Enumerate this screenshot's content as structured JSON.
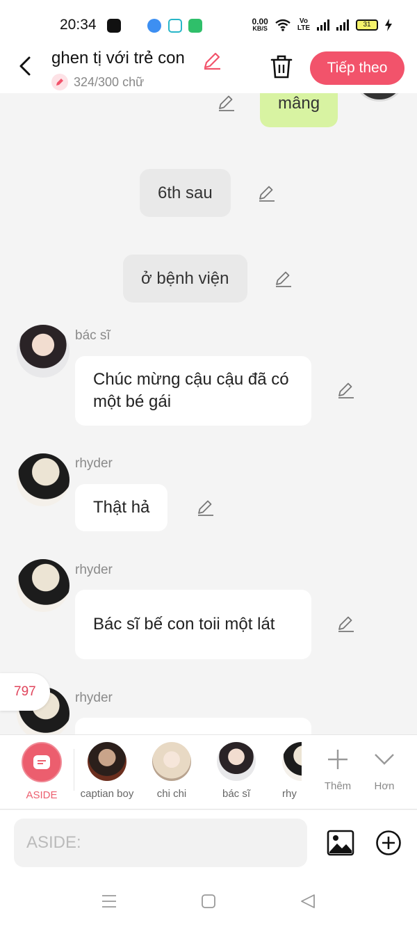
{
  "status": {
    "time": "20:34",
    "speed_value": "0.00",
    "speed_unit": "KB/S",
    "volte_top": "Vo",
    "volte_bottom": "LTE",
    "battery": "31"
  },
  "header": {
    "title": "ghen tị với trẻ con",
    "char_count": "324/300 chữ",
    "next_label": "Tiếp theo"
  },
  "messages": [
    {
      "speaker": "",
      "text": "mâng",
      "style": "green"
    },
    {
      "speaker": "",
      "text": "6th sau",
      "style": "gray"
    },
    {
      "speaker": "",
      "text": "ở bệnh viện",
      "style": "gray"
    },
    {
      "speaker": "bác sĩ",
      "text": "Chúc mừng cậu cậu đã có một bé gái",
      "style": "white"
    },
    {
      "speaker": "rhyder",
      "text": "Thật hả",
      "style": "white"
    },
    {
      "speaker": "rhyder",
      "text": "Bác sĩ bế con toii một lát",
      "style": "white"
    },
    {
      "speaker": "rhyder",
      "text": "",
      "style": "white"
    }
  ],
  "unread_count": "797",
  "characters": [
    {
      "label": "ASIDE"
    },
    {
      "label": "captian boy"
    },
    {
      "label": "chi chi"
    },
    {
      "label": "bác sĩ"
    },
    {
      "label": "rhy"
    }
  ],
  "tools": {
    "more_label": "Thêm",
    "less_label": "Hơn"
  },
  "input": {
    "placeholder": "ASIDE:"
  },
  "colors": {
    "accent": "#f2536b",
    "user_bubble": "#d8f3a2",
    "narration_bubble": "#e9e9e9"
  }
}
